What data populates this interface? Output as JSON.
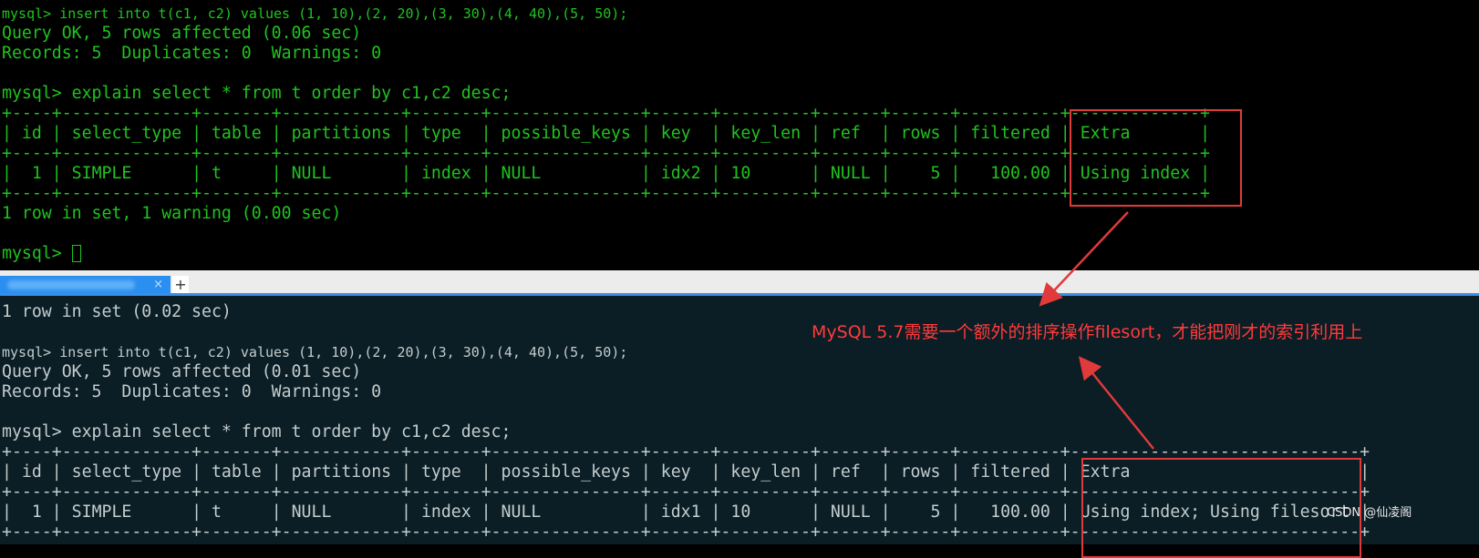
{
  "top": {
    "lines": [
      "mysql> insert into t(c1, c2) values (1, 10),(2, 20),(3, 30),(4, 40),(5, 50);",
      "Query OK, 5 rows affected (0.06 sec)",
      "Records: 5  Duplicates: 0  Warnings: 0",
      "",
      "mysql> explain select * from t order by c1,c2 desc;"
    ],
    "table": {
      "headers": [
        "id",
        "select_type",
        "table",
        "partitions",
        "type",
        "possible_keys",
        "key",
        "key_len",
        "ref",
        "rows",
        "filtered",
        "Extra"
      ],
      "rows": [
        [
          "1",
          "SIMPLE",
          "t",
          "NULL",
          "index",
          "NULL",
          "idx2",
          "10",
          "NULL",
          "5",
          "100.00",
          "Using index"
        ]
      ]
    },
    "after": [
      "1 row in set, 1 warning (0.00 sec)",
      "",
      "mysql> "
    ]
  },
  "tabbar": {
    "plus_label": "+",
    "close_label": "×"
  },
  "bottom": {
    "lines": [
      "1 row in set (0.02 sec)",
      "",
      "mysql> insert into t(c1, c2) values (1, 10),(2, 20),(3, 30),(4, 40),(5, 50);",
      "Query OK, 5 rows affected (0.01 sec)",
      "Records: 5  Duplicates: 0  Warnings: 0",
      "",
      "mysql> explain select * from t order by c1,c2 desc;"
    ],
    "table": {
      "headers": [
        "id",
        "select_type",
        "table",
        "partitions",
        "type",
        "possible_keys",
        "key",
        "key_len",
        "ref",
        "rows",
        "filtered",
        "Extra"
      ],
      "rows": [
        [
          "1",
          "SIMPLE",
          "t",
          "NULL",
          "index",
          "NULL",
          "idx1",
          "10",
          "NULL",
          "5",
          "100.00",
          "Using index; Using filesort"
        ]
      ]
    }
  },
  "annotation": {
    "text": "MySQL 5.7需要一个额外的排序操作filesort，才能把刚才的索引利用上",
    "color": "#ff3b3b"
  },
  "watermark": "CSDN @仙凌阁",
  "colors": {
    "top_text": "#1fc41f",
    "bottom_text": "#c3cdcd",
    "bottom_bg": "#0b1d25",
    "highlight": "#e03a3a"
  }
}
